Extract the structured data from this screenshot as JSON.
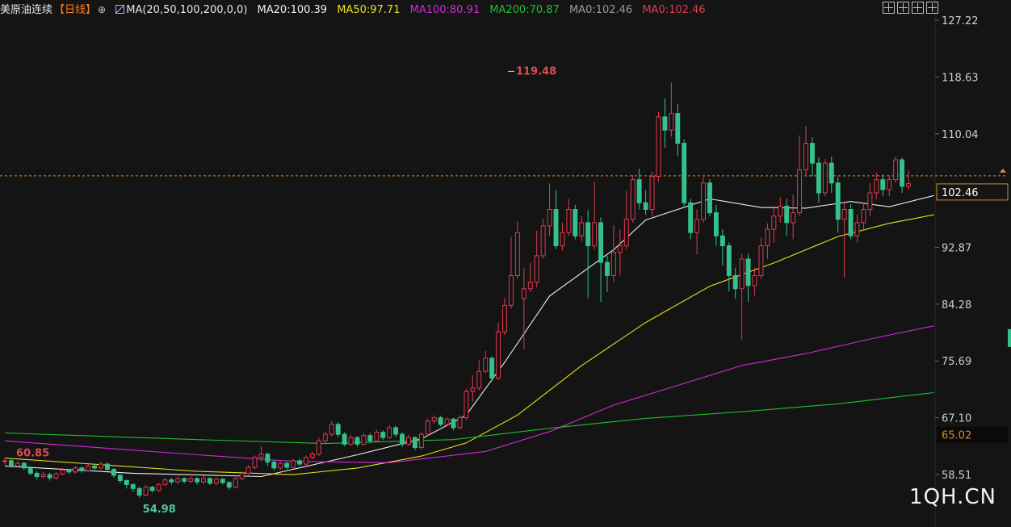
{
  "header": {
    "instrument": "美原油连续",
    "period": "【日线】",
    "cross_icon": "crosshair-icon",
    "ma_icon": "indicator-icon",
    "ma_params": "MA(20,50,100,200,0,0)",
    "ma20": "MA20:100.39",
    "ma50": "MA50:97.71",
    "ma100": "MA100:80.91",
    "ma200": "MA200:70.87",
    "ma0a": "MA0:102.46",
    "ma0b": "MA0:102.46"
  },
  "toolbar": {
    "icons": [
      "grid-layout-icon",
      "split-layout-icon",
      "prev-page-icon",
      "next-page-icon"
    ]
  },
  "watermark": "1QH.CN",
  "colors": {
    "background": "#141414",
    "up": "#e03a4e",
    "down": "#35c18e",
    "ma20": "#eeeeee",
    "ma50": "#e8e01c",
    "ma100": "#d02ad6",
    "ma200": "#1fbf2c",
    "price_line": "#e08a2a"
  },
  "chart_data": {
    "type": "candlestick",
    "ylim": [
      52,
      129
    ],
    "y_ticks": [
      "127.22",
      "118.63",
      "110.04",
      "92.87",
      "84.28",
      "75.69",
      "67.10",
      "58.51"
    ],
    "current_price": "102.46",
    "ma200_tag": "65.02",
    "high_annotation": "119.48",
    "low_annotation": "54.98",
    "left_annotation": "60.85",
    "candles": [
      [
        60.5,
        60.6,
        60.0,
        61.1
      ],
      [
        60.6,
        59.8,
        59.5,
        61.0
      ],
      [
        59.8,
        60.2,
        59.6,
        60.6
      ],
      [
        60.2,
        59.5,
        59.2,
        60.5
      ],
      [
        59.5,
        58.7,
        58.4,
        59.8
      ],
      [
        58.7,
        58.2,
        57.8,
        59.0
      ],
      [
        58.2,
        58.5,
        57.9,
        58.9
      ],
      [
        58.5,
        58.0,
        57.6,
        58.8
      ],
      [
        58.0,
        58.6,
        57.7,
        58.9
      ],
      [
        58.6,
        59.2,
        58.4,
        59.5
      ],
      [
        59.2,
        58.9,
        58.6,
        59.4
      ],
      [
        58.9,
        59.5,
        58.7,
        59.8
      ],
      [
        59.5,
        59.1,
        58.8,
        59.7
      ],
      [
        59.1,
        59.8,
        58.9,
        60.1
      ],
      [
        59.8,
        59.5,
        59.2,
        60.2
      ],
      [
        59.5,
        60.1,
        59.3,
        60.4
      ],
      [
        60.1,
        59.3,
        59.0,
        60.3
      ],
      [
        59.3,
        58.4,
        58.0,
        59.5
      ],
      [
        58.4,
        57.6,
        57.2,
        58.6
      ],
      [
        57.6,
        57.0,
        56.4,
        57.8
      ],
      [
        57.0,
        56.4,
        55.9,
        57.2
      ],
      [
        56.4,
        55.4,
        54.98,
        56.6
      ],
      [
        55.4,
        56.6,
        55.2,
        56.9
      ],
      [
        56.6,
        56.1,
        55.8,
        56.8
      ],
      [
        56.1,
        57.0,
        55.9,
        57.3
      ],
      [
        57.0,
        57.7,
        56.8,
        58.0
      ],
      [
        57.7,
        57.4,
        57.0,
        58.0
      ],
      [
        57.4,
        57.9,
        57.1,
        58.2
      ],
      [
        57.9,
        57.5,
        57.2,
        58.1
      ],
      [
        57.5,
        57.9,
        57.2,
        58.2
      ],
      [
        57.9,
        57.4,
        57.0,
        58.1
      ],
      [
        57.4,
        57.9,
        57.1,
        58.3
      ],
      [
        57.9,
        57.2,
        56.9,
        58.1
      ],
      [
        57.2,
        57.8,
        56.9,
        58.0
      ],
      [
        57.8,
        57.3,
        57.0,
        58.0
      ],
      [
        57.3,
        56.6,
        56.2,
        57.5
      ],
      [
        56.6,
        57.9,
        56.4,
        58.1
      ],
      [
        57.9,
        58.7,
        57.6,
        59.0
      ],
      [
        58.7,
        59.6,
        58.4,
        59.9
      ],
      [
        59.6,
        61.1,
        59.3,
        61.4
      ],
      [
        61.1,
        61.6,
        60.5,
        62.8
      ],
      [
        61.6,
        60.4,
        59.8,
        61.8
      ],
      [
        60.4,
        59.5,
        59.1,
        60.7
      ],
      [
        59.5,
        60.2,
        59.2,
        60.5
      ],
      [
        60.2,
        59.6,
        59.3,
        60.4
      ],
      [
        59.6,
        60.6,
        59.4,
        60.9
      ],
      [
        60.6,
        60.1,
        59.8,
        60.9
      ],
      [
        60.1,
        61.1,
        59.9,
        61.4
      ],
      [
        61.1,
        61.6,
        60.8,
        61.9
      ],
      [
        61.6,
        63.6,
        61.3,
        64.1
      ],
      [
        63.6,
        64.6,
        63.2,
        65.0
      ],
      [
        64.6,
        66.1,
        64.3,
        66.6
      ],
      [
        66.1,
        64.6,
        64.2,
        66.4
      ],
      [
        64.6,
        63.1,
        62.8,
        64.9
      ],
      [
        63.1,
        64.1,
        62.9,
        64.5
      ],
      [
        64.1,
        63.1,
        62.7,
        64.3
      ],
      [
        63.1,
        64.4,
        62.9,
        64.8
      ],
      [
        64.4,
        63.6,
        63.2,
        64.8
      ],
      [
        63.6,
        64.9,
        63.4,
        65.3
      ],
      [
        64.9,
        64.1,
        63.7,
        65.2
      ],
      [
        64.1,
        65.6,
        63.9,
        66.0
      ],
      [
        65.6,
        64.6,
        64.2,
        65.9
      ],
      [
        64.6,
        63.1,
        62.7,
        64.9
      ],
      [
        63.1,
        64.1,
        62.9,
        64.5
      ],
      [
        64.1,
        62.6,
        62.2,
        64.3
      ],
      [
        62.6,
        64.6,
        62.3,
        65.0
      ],
      [
        64.6,
        66.6,
        64.3,
        67.0
      ],
      [
        66.6,
        67.1,
        66.2,
        67.5
      ],
      [
        67.1,
        66.1,
        65.8,
        67.4
      ],
      [
        66.1,
        66.9,
        65.8,
        67.2
      ],
      [
        66.9,
        65.6,
        65.2,
        67.1
      ],
      [
        65.6,
        67.1,
        65.3,
        67.5
      ],
      [
        67.1,
        71.1,
        66.8,
        71.5
      ],
      [
        71.1,
        71.6,
        69.5,
        73.5
      ],
      [
        71.6,
        74.1,
        71.2,
        75.8
      ],
      [
        74.1,
        76.1,
        73.8,
        77.2
      ],
      [
        76.1,
        73.1,
        72.6,
        76.4
      ],
      [
        73.1,
        80.1,
        72.8,
        81.5
      ],
      [
        80.1,
        84.1,
        79.6,
        85.2
      ],
      [
        84.1,
        88.6,
        83.6,
        94.5
      ],
      [
        88.6,
        95.1,
        88.1,
        96.8
      ],
      [
        85.1,
        86.6,
        77.5,
        89.8
      ],
      [
        86.6,
        87.6,
        86.1,
        90.5
      ],
      [
        87.6,
        91.6,
        86.8,
        95.4
      ],
      [
        91.6,
        96.1,
        91.1,
        97.2
      ],
      [
        96.1,
        98.6,
        94.6,
        102.5
      ],
      [
        98.6,
        93.1,
        92.6,
        101.5
      ],
      [
        93.1,
        95.1,
        92.4,
        96.6
      ],
      [
        95.1,
        98.6,
        94.6,
        100.2
      ],
      [
        98.6,
        94.6,
        94.1,
        99.3
      ],
      [
        94.6,
        96.6,
        93.8,
        97.6
      ],
      [
        96.6,
        93.1,
        85.2,
        98.5
      ],
      [
        93.1,
        96.6,
        92.6,
        102.8
      ],
      [
        96.6,
        90.6,
        84.6,
        97.4
      ],
      [
        90.6,
        88.6,
        86.1,
        91.6
      ],
      [
        88.6,
        92.1,
        87.6,
        96.2
      ],
      [
        92.1,
        93.1,
        88.6,
        95.6
      ],
      [
        93.1,
        97.1,
        92.6,
        101.4
      ],
      [
        97.1,
        103.1,
        96.6,
        103.8
      ],
      [
        103.1,
        99.6,
        98.6,
        104.8
      ],
      [
        99.6,
        98.6,
        97.8,
        101.5
      ],
      [
        98.6,
        103.6,
        97.6,
        104.3
      ],
      [
        103.6,
        112.6,
        102.8,
        113.4
      ],
      [
        112.6,
        110.6,
        107.9,
        115.4
      ],
      [
        110.6,
        113.1,
        109.6,
        117.8
      ],
      [
        113.1,
        108.6,
        106.6,
        114.5
      ],
      [
        108.6,
        99.6,
        99.1,
        109.2
      ],
      [
        99.6,
        95.1,
        94.1,
        100.2
      ],
      [
        95.1,
        97.1,
        91.8,
        98.6
      ],
      [
        97.1,
        102.6,
        96.6,
        103.5
      ],
      [
        102.6,
        98.1,
        97.6,
        103.2
      ],
      [
        98.1,
        94.6,
        93.1,
        99.3
      ],
      [
        94.6,
        93.1,
        90.1,
        95.6
      ],
      [
        93.1,
        88.6,
        86.2,
        93.6
      ],
      [
        88.6,
        86.6,
        85.1,
        89.8
      ],
      [
        86.6,
        91.1,
        78.8,
        91.9
      ],
      [
        91.1,
        87.1,
        84.6,
        91.9
      ],
      [
        87.1,
        88.6,
        85.6,
        89.8
      ],
      [
        88.6,
        93.1,
        88.1,
        94.4
      ],
      [
        93.1,
        95.6,
        91.1,
        96.5
      ],
      [
        95.6,
        97.6,
        93.6,
        99.2
      ],
      [
        97.6,
        99.1,
        96.6,
        100.5
      ],
      [
        99.1,
        96.6,
        94.6,
        100.2
      ],
      [
        96.6,
        98.1,
        94.1,
        100.8
      ],
      [
        98.1,
        104.6,
        97.6,
        109.8
      ],
      [
        104.6,
        108.6,
        103.6,
        111.2
      ],
      [
        108.6,
        105.6,
        103.6,
        109.5
      ],
      [
        105.6,
        101.1,
        99.6,
        106.5
      ],
      [
        101.1,
        105.6,
        100.6,
        106.2
      ],
      [
        105.6,
        102.6,
        101.1,
        106.6
      ],
      [
        102.6,
        97.1,
        95.1,
        103.5
      ],
      [
        97.1,
        98.6,
        88.3,
        99.8
      ],
      [
        98.6,
        94.6,
        94.1,
        99.4
      ],
      [
        94.6,
        96.6,
        93.6,
        97.8
      ],
      [
        96.6,
        98.6,
        95.6,
        99.7
      ],
      [
        98.6,
        101.1,
        97.6,
        102.6
      ],
      [
        101.1,
        103.1,
        100.1,
        104.2
      ],
      [
        103.1,
        101.6,
        100.6,
        103.9
      ],
      [
        101.6,
        103.1,
        100.6,
        103.8
      ],
      [
        103.1,
        106.1,
        102.6,
        106.6
      ],
      [
        106.1,
        102.1,
        101.1,
        106.4
      ],
      [
        102.1,
        102.5,
        101.6,
        104.5
      ]
    ],
    "ma_lines": [
      {
        "name": "MA20",
        "points": [
          [
            0,
            59.8
          ],
          [
            20,
            58.7
          ],
          [
            40,
            58.2
          ],
          [
            55,
            61.5
          ],
          [
            65,
            63.9
          ],
          [
            72,
            67.5
          ],
          [
            78,
            75.5
          ],
          [
            85,
            85.5
          ],
          [
            95,
            92.5
          ],
          [
            100,
            97.0
          ],
          [
            110,
            100.2
          ],
          [
            118,
            98.9
          ],
          [
            125,
            98.8
          ],
          [
            132,
            99.8
          ],
          [
            138,
            99.0
          ],
          [
            145,
            100.7
          ]
        ]
      },
      {
        "name": "MA50",
        "points": [
          [
            0,
            61.0
          ],
          [
            30,
            59.0
          ],
          [
            45,
            58.5
          ],
          [
            55,
            59.5
          ],
          [
            65,
            61.3
          ],
          [
            72,
            63.3
          ],
          [
            80,
            67.5
          ],
          [
            90,
            75.0
          ],
          [
            100,
            81.5
          ],
          [
            110,
            87.0
          ],
          [
            120,
            90.5
          ],
          [
            130,
            94.5
          ],
          [
            138,
            96.5
          ],
          [
            145,
            97.8
          ]
        ]
      },
      {
        "name": "MA100",
        "points": [
          [
            0,
            63.6
          ],
          [
            30,
            61.5
          ],
          [
            45,
            60.5
          ],
          [
            60,
            60.3
          ],
          [
            75,
            62.0
          ],
          [
            85,
            65.0
          ],
          [
            95,
            69.0
          ],
          [
            105,
            72.0
          ],
          [
            115,
            75.0
          ],
          [
            125,
            76.8
          ],
          [
            135,
            79.0
          ],
          [
            145,
            81.0
          ]
        ]
      },
      {
        "name": "MA200",
        "points": [
          [
            0,
            64.8
          ],
          [
            30,
            63.8
          ],
          [
            50,
            63.2
          ],
          [
            70,
            63.8
          ],
          [
            85,
            65.5
          ],
          [
            100,
            67.0
          ],
          [
            115,
            68.0
          ],
          [
            130,
            69.2
          ],
          [
            145,
            70.9
          ]
        ]
      }
    ]
  }
}
